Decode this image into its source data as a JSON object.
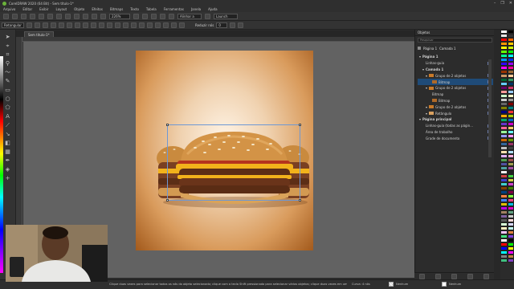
{
  "window": {
    "title": "CorelDRAW 2020 (64 Bit) - Sem título-1*",
    "controls": [
      "–",
      "❐",
      "✕"
    ]
  },
  "menu": [
    "Arquivo",
    "Editar",
    "Exibir",
    "Layout",
    "Objeto",
    "Efeitos",
    "Bitmaps",
    "Texto",
    "Tabela",
    "Ferramentas",
    "Janela",
    "Ajuda"
  ],
  "toolbar": {
    "zoom_value": "226%",
    "snap_label": "Alinhar a",
    "launch_label": "Launch"
  },
  "propbar": {
    "shape_select": "Retangular",
    "reduce_nodes_label": "Reduzir nós",
    "reduce_nodes_value": "0"
  },
  "document": {
    "tab_label": "Sem título-1*"
  },
  "docker": {
    "title": "Objetos",
    "search_placeholder": "Pesquisar",
    "path_page": "Página 1",
    "path_layer": "Camada 1",
    "tree": [
      {
        "label": "Página 1",
        "level": 0,
        "bold": true,
        "highlight": false,
        "thumb": ""
      },
      {
        "label": "Linhas-guia",
        "level": 1,
        "bold": false,
        "highlight": false,
        "thumb": ""
      },
      {
        "label": "Camada 1",
        "level": 1,
        "bold": true,
        "highlight": false,
        "thumb": ""
      },
      {
        "label": "Grupo de 2 objetos",
        "level": 2,
        "bold": false,
        "highlight": false,
        "thumb": "#c87a2a"
      },
      {
        "label": "Bitmap",
        "level": 3,
        "bold": false,
        "highlight": true,
        "thumb": "#b06a28"
      },
      {
        "label": "Grupo de 2 objetos",
        "level": 2,
        "bold": false,
        "highlight": false,
        "thumb": "#c87a2a"
      },
      {
        "label": "Bitmap",
        "level": 3,
        "bold": false,
        "highlight": false,
        "thumb": ""
      },
      {
        "label": "Bitmap",
        "level": 3,
        "bold": false,
        "highlight": false,
        "thumb": "#b06a28"
      },
      {
        "label": "Grupo de 2 objetos",
        "level": 2,
        "bold": false,
        "highlight": false,
        "thumb": "#c87a2a"
      },
      {
        "label": "Retângulo",
        "level": 2,
        "bold": false,
        "highlight": false,
        "thumb": "#d9a060"
      },
      {
        "label": "Página principal",
        "level": 0,
        "bold": true,
        "highlight": false,
        "thumb": ""
      },
      {
        "label": "Linhas-guia (todas as págin...",
        "level": 1,
        "bold": false,
        "highlight": false,
        "thumb": ""
      },
      {
        "label": "Área de trabalho",
        "level": 1,
        "bold": false,
        "highlight": false,
        "thumb": ""
      },
      {
        "label": "Grade de documento",
        "level": 1,
        "bold": false,
        "highlight": false,
        "thumb": ""
      }
    ]
  },
  "status": {
    "hint": "Clique duas vezes para selecionar todos os nós do objeto selecionado; clique com a tecla Shift pressionada para selecionar vários objetos; clique duas vezes em uma curva para adicionar um nó; clique duas vezes em um nó para removê-lo",
    "curve_info": "Curva: 4 nós",
    "fill_label": "Nenhum",
    "outline_label": "Nenhum"
  },
  "colors": {
    "accent": "#1f4b78",
    "selection": "#6e98d4",
    "page_center": "#fff5e8",
    "page_edge": "#a35a1c"
  },
  "palette_colors": [
    "#ffffff",
    "#000000",
    "#e6e6e6",
    "#333333",
    "#ff0000",
    "#ff6600",
    "#ff9900",
    "#ffcc00",
    "#ffff00",
    "#ccff00",
    "#66ff00",
    "#00ff00",
    "#00ff99",
    "#00ffff",
    "#0099ff",
    "#0033ff",
    "#3300ff",
    "#9900ff",
    "#ff00ff",
    "#ff0099",
    "#993300",
    "#996633",
    "#cc9966",
    "#ffcc99",
    "#006633",
    "#339966",
    "#66ccff",
    "#003366",
    "#660066",
    "#cc3366",
    "#ff9999",
    "#99ccff",
    "#ccffcc",
    "#ffffcc",
    "#cccccc",
    "#999999",
    "#666666",
    "#800000",
    "#808000",
    "#008080",
    "#000080",
    "#ff3333",
    "#ffaa00",
    "#aacc00",
    "#00aa66",
    "#0066cc",
    "#6633cc",
    "#cc00cc",
    "#ff6699",
    "#ffcc66",
    "#99ff99",
    "#66ffff",
    "#9999ff",
    "#ff99ff",
    "#cc6600",
    "#669900",
    "#336699",
    "#993366",
    "#c0c0c0",
    "#404040",
    "#ffe0b0",
    "#b0e0ff",
    "#e0b0ff",
    "#ffb0e0",
    "#50a050",
    "#a05050",
    "#5050a0",
    "#a0a050",
    "#50a0a0",
    "#a050a0",
    "#f0f0f0",
    "#202020",
    "#d04040",
    "#40d040",
    "#4040d0",
    "#d0d040",
    "#40d0d0",
    "#d040d0",
    "#804000",
    "#408000",
    "#004080",
    "#800040",
    "#ff8040",
    "#80ff40",
    "#4080ff",
    "#ff4080",
    "#e0c000",
    "#00c0e0",
    "#c000e0",
    "#e000c0",
    "#a08060",
    "#60a080",
    "#8060a0",
    "#c8c8c8",
    "#585858",
    "#ffd8d8",
    "#d8ffd8",
    "#d8d8ff",
    "#fff0c0",
    "#c0fff0",
    "#f0c0ff",
    "#e08040",
    "#40e080",
    "#8040e0",
    "#ffffff",
    "#000000",
    "#ff0000",
    "#00ff00",
    "#0000ff",
    "#ffff00",
    "#00ffff",
    "#ff00ff",
    "#808080",
    "#c08040",
    "#40c080",
    "#8040c0"
  ]
}
